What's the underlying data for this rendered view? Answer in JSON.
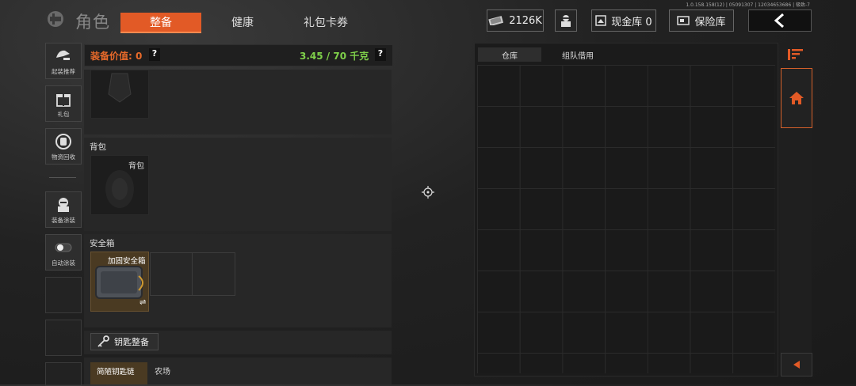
{
  "version": "1.0.158.158(12) | 05091307 | 12034653686 | 极致-7",
  "header": {
    "title": "角色",
    "tabs": [
      {
        "label": "整备",
        "active": true
      },
      {
        "label": "健康",
        "active": false
      },
      {
        "label": "礼包卡券",
        "active": false
      }
    ],
    "currency": "2126K",
    "cash_vault": "现金库 0",
    "insurance": "保险库"
  },
  "sidebar": {
    "items": [
      {
        "label": "起装推荐",
        "icon": "loadout-icon"
      },
      {
        "label": "礼包",
        "icon": "gift-icon"
      },
      {
        "label": "物资回收",
        "icon": "recycle-icon"
      },
      {
        "label": "装备涂装",
        "icon": "paint-icon"
      },
      {
        "label": "自动涂装",
        "icon": "toggle-icon"
      }
    ]
  },
  "equipment": {
    "value_label": "装备价值: 0",
    "weight_label": "3.45 / 70 千克",
    "help": "?",
    "backpack_title": "背包",
    "backpack_slot": "背包",
    "safebox_title": "安全箱",
    "safebox_item": "加固安全箱",
    "swap_icon": "⇌",
    "key_button": "钥匙整备",
    "keychain_item": "简陋钥匙链",
    "keychain_map": "农场"
  },
  "stash": {
    "tabs": [
      {
        "label": "仓库",
        "active": true
      },
      {
        "label": "组队借用",
        "active": false
      }
    ]
  },
  "colors": {
    "accent": "#e25a26",
    "weight_green": "#7fd04a",
    "value_orange": "#e86a2a"
  }
}
